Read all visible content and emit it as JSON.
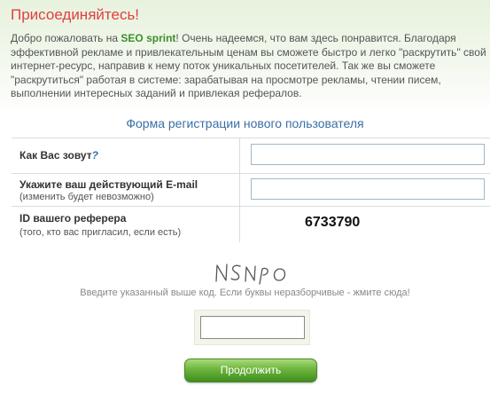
{
  "header": {
    "title": "Присоединяйтесь!",
    "intro_before": "Добро пожаловать на ",
    "brand": "SEO sprint",
    "intro_after": "! Очень надеемся, что вам здесь понравится. Благодаря эффективной рекламе и привлекательным ценам вы сможете быстро и легко \"раскрутить\" свой интернет-ресурс, направив к нему поток уникальных посетителей. Так же вы сможете \"раскрутиться\" работая в системе: зарабатывая на просмотре рекламы, чтении писем, выполнении интересных заданий и привлекая рефералов."
  },
  "form": {
    "title": "Форма регистрации нового пользователя",
    "name_label": "Как Вас зовут",
    "name_question": "?",
    "name_value": "",
    "email_label": "Укажите ваш действующий E-mail",
    "email_hint": "(изменить будет невозможно)",
    "email_value": "",
    "referer_label": "ID вашего реферера",
    "referer_hint": "(того, кто вас пригласил, если есть)",
    "referer_id": "6733790"
  },
  "captcha": {
    "code_image_text": "NSNPO",
    "hint": "Введите указанный выше код. Если буквы неразборчивые - жмите сюда!",
    "value": ""
  },
  "actions": {
    "continue_label": "Продолжить"
  },
  "colors": {
    "title": "#e04040",
    "brand": "#3d8f2a",
    "form_title": "#3a6fa5",
    "button_green": "#6cb43c"
  }
}
